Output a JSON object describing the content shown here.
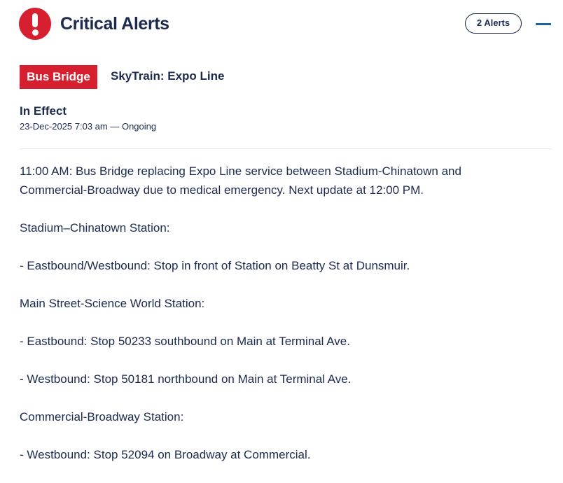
{
  "header": {
    "title": "Critical Alerts",
    "alert_count_label": "2 Alerts"
  },
  "alert": {
    "badge": "Bus Bridge",
    "route": "SkyTrain: Expo Line",
    "status": "In Effect",
    "timeline": "23-Dec-2025 7:03 am — Ongoing",
    "paragraphs": [
      "11:00 AM: Bus Bridge replacing Expo Line service between Stadium-Chinatown and Commercial-Broadway due to medical emergency. Next update at 12:00 PM.",
      "Stadium–Chinatown Station:",
      "- Eastbound/Westbound: Stop in front of Station on Beatty St at Dunsmuir.",
      "Main Street-Science World Station:",
      "- Eastbound: Stop 50233 southbound on Main at Terminal Ave.",
      "- Westbound: Stop 50181 northbound on Main at Terminal Ave.",
      "Commercial-Broadway Station:",
      "- Westbound: Stop 52094 on Broadway at Commercial."
    ]
  },
  "colors": {
    "brand_navy": "#1b2a4e",
    "alert_red": "#d6202f",
    "accent_blue": "#1b67a6"
  },
  "icons": {
    "alert": "exclamation-circle-icon",
    "collapse": "minus-icon"
  }
}
